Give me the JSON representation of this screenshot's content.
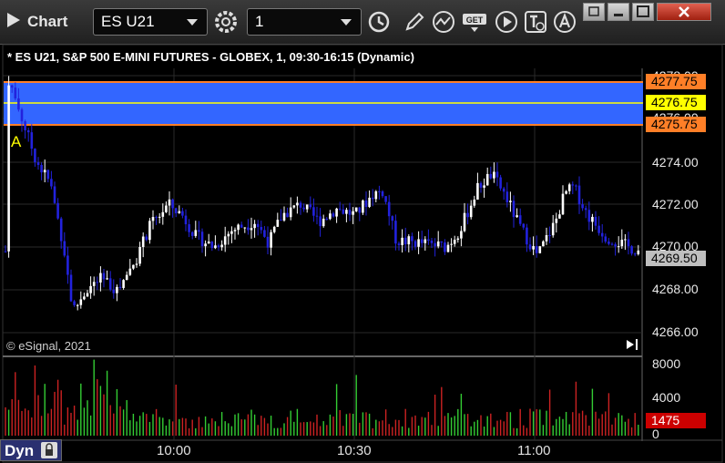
{
  "window": {
    "title": "Chart",
    "symbol": "ES U21",
    "interval": "1",
    "get_label": "GET"
  },
  "chart": {
    "header": "* ES U21, S&P 500 E-MINI FUTURES - GLOBEX, 1, 09:30-16:15 (Dynamic)",
    "copyright": "© eSignal, 2021",
    "annotation": "A",
    "price_axis": [
      "4278.00",
      "4276.00",
      "4274.00",
      "4272.00",
      "4270.00",
      "4268.00",
      "4266.00"
    ],
    "volume_axis": [
      "8000",
      "4000",
      "0"
    ],
    "time_axis": [
      "10:00",
      "10:30",
      "11:00"
    ],
    "tags": {
      "band_top": "4277.75",
      "band_mid": "4276.75",
      "band_bottom": "4275.75",
      "last_price": "4269.50",
      "last_volume": "1475"
    },
    "colors": {
      "band": "#3366ff",
      "band_edge": "#ff7f27",
      "mid_line": "#ffff00",
      "up": "#ffffff",
      "down": "#2222dd",
      "vol_up": "#33cc33",
      "vol_down": "#cc2222",
      "last_volume_tag": "#cc0000"
    }
  },
  "footer": {
    "mode": "Dyn"
  }
}
